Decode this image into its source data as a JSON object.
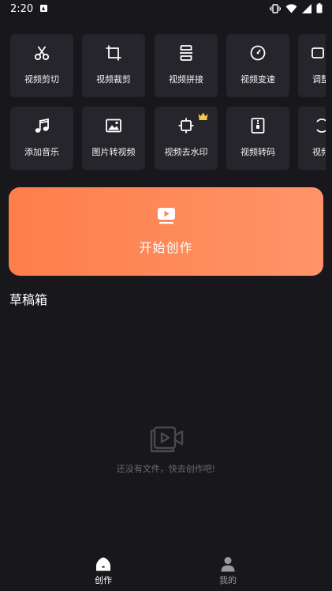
{
  "status_bar": {
    "time": "2:20",
    "icons": [
      "notification-a-icon",
      "vibrate-icon",
      "wifi-icon",
      "signal-icon",
      "battery-icon"
    ]
  },
  "tools": [
    {
      "label": "视频剪切",
      "icon": "scissors-icon"
    },
    {
      "label": "视频裁剪",
      "icon": "crop-icon"
    },
    {
      "label": "视频拼接",
      "icon": "merge-icon"
    },
    {
      "label": "视频变速",
      "icon": "speed-dial-icon"
    },
    {
      "label": "调整",
      "icon": "adjust-icon"
    },
    {
      "label": "添加音乐",
      "icon": "music-note-icon"
    },
    {
      "label": "图片转视频",
      "icon": "image-icon"
    },
    {
      "label": "视频去水印",
      "icon": "watermark-remove-icon",
      "vip": true
    },
    {
      "label": "视频转码",
      "icon": "zip-file-icon"
    },
    {
      "label": "视频",
      "icon": "rotate-icon"
    }
  ],
  "create_banner": {
    "label": "开始创作",
    "icon": "video-play-icon"
  },
  "drafts": {
    "title": "草稿箱",
    "empty_text": "还没有文件，快去创作吧!"
  },
  "bottom_nav": {
    "create_label": "创作",
    "mine_label": "我的"
  },
  "colors": {
    "background": "#18171c",
    "tile": "#26252b",
    "banner_start": "#fe7e4a",
    "banner_end": "#ff9468",
    "vip_crown": "#f6c744"
  }
}
